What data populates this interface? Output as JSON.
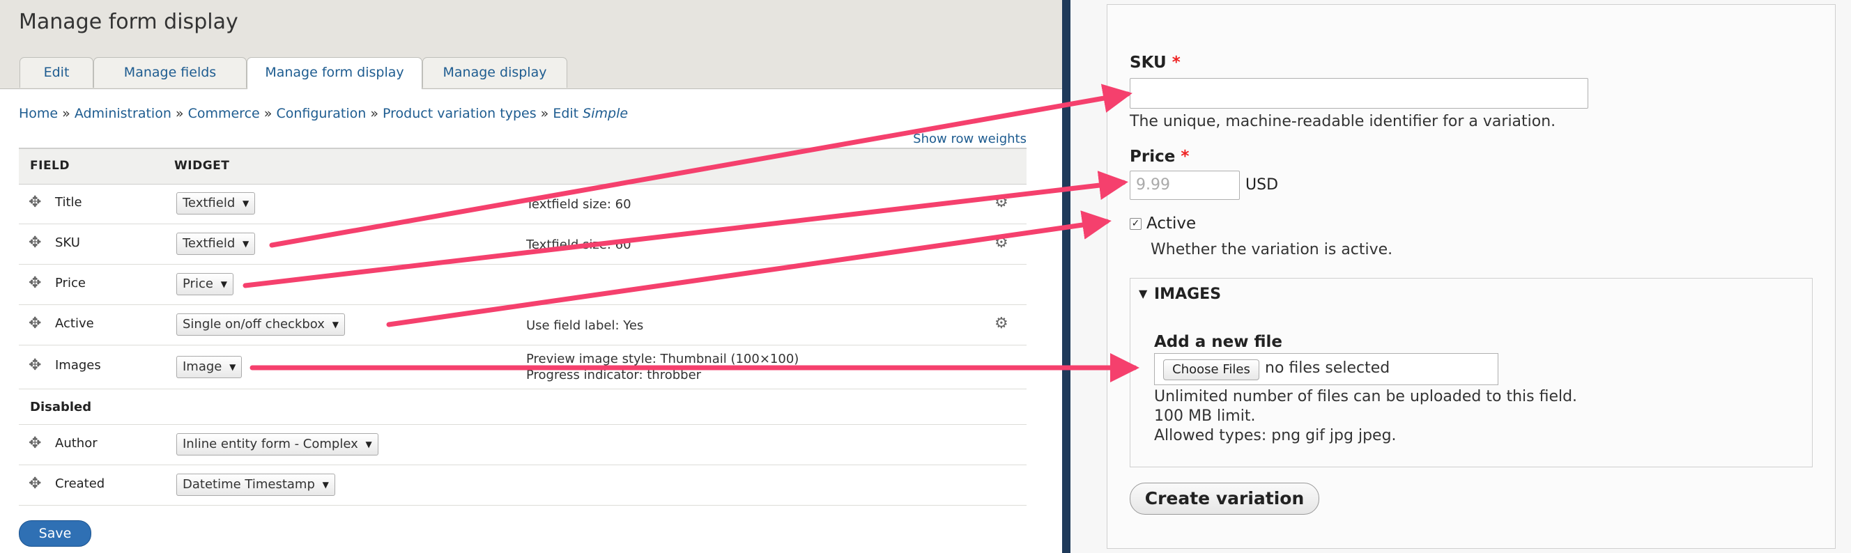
{
  "left": {
    "title": "Manage form display",
    "tabs": [
      "Edit",
      "Manage fields",
      "Manage form display",
      "Manage display"
    ],
    "breadcrumb": {
      "items": [
        "Home",
        "Administration",
        "Commerce",
        "Configuration",
        "Product variation types"
      ],
      "separator": "»",
      "edit_prefix": "Edit",
      "edit_target": "Simple"
    },
    "show_row_weights": "Show row weights",
    "table": {
      "headers": [
        "FIELD",
        "WIDGET"
      ],
      "rows": [
        {
          "field": "Title",
          "widget": "Textfield",
          "summary": "Textfield size: 60",
          "summary2": ""
        },
        {
          "field": "SKU",
          "widget": "Textfield",
          "summary": "Textfield size: 60",
          "summary2": ""
        },
        {
          "field": "Price",
          "widget": "Price",
          "summary": "",
          "summary2": ""
        },
        {
          "field": "Active",
          "widget": "Single on/off checkbox",
          "summary": "Use field label: Yes",
          "summary2": ""
        },
        {
          "field": "Images",
          "widget": "Image",
          "summary": "Preview image style: Thumbnail (100×100)",
          "summary2": "Progress indicator: throbber"
        }
      ],
      "disabled_label": "Disabled",
      "disabled_rows": [
        {
          "field": "Author",
          "widget": "Inline entity form - Complex"
        },
        {
          "field": "Created",
          "widget": "Datetime Timestamp"
        }
      ]
    },
    "save_label": "Save"
  },
  "right": {
    "sku": {
      "label": "SKU",
      "required": "*",
      "value": "",
      "description": "The unique, machine-readable identifier for a variation."
    },
    "price": {
      "label": "Price",
      "required": "*",
      "placeholder": "9.99",
      "currency": "USD"
    },
    "active": {
      "label": "Active",
      "checked": "✓",
      "description": "Whether the variation is active."
    },
    "images": {
      "legend": "IMAGES",
      "toggle": "▼",
      "add_label": "Add a new file",
      "choose_button": "Choose Files",
      "no_files": "no files selected",
      "help1": "Unlimited number of files can be uploaded to this field.",
      "help2": "100 MB limit.",
      "help3": "Allowed types: png gif jpg jpeg."
    },
    "create_label": "Create variation"
  },
  "icons": {
    "drag": "drag-handle-icon",
    "gear": "gear-icon",
    "caret": "caret-down-icon"
  },
  "colors": {
    "arrow": "#f5406d",
    "link": "#1e5c90",
    "save": "#2f70b4",
    "divider": "#1f3a5a"
  }
}
